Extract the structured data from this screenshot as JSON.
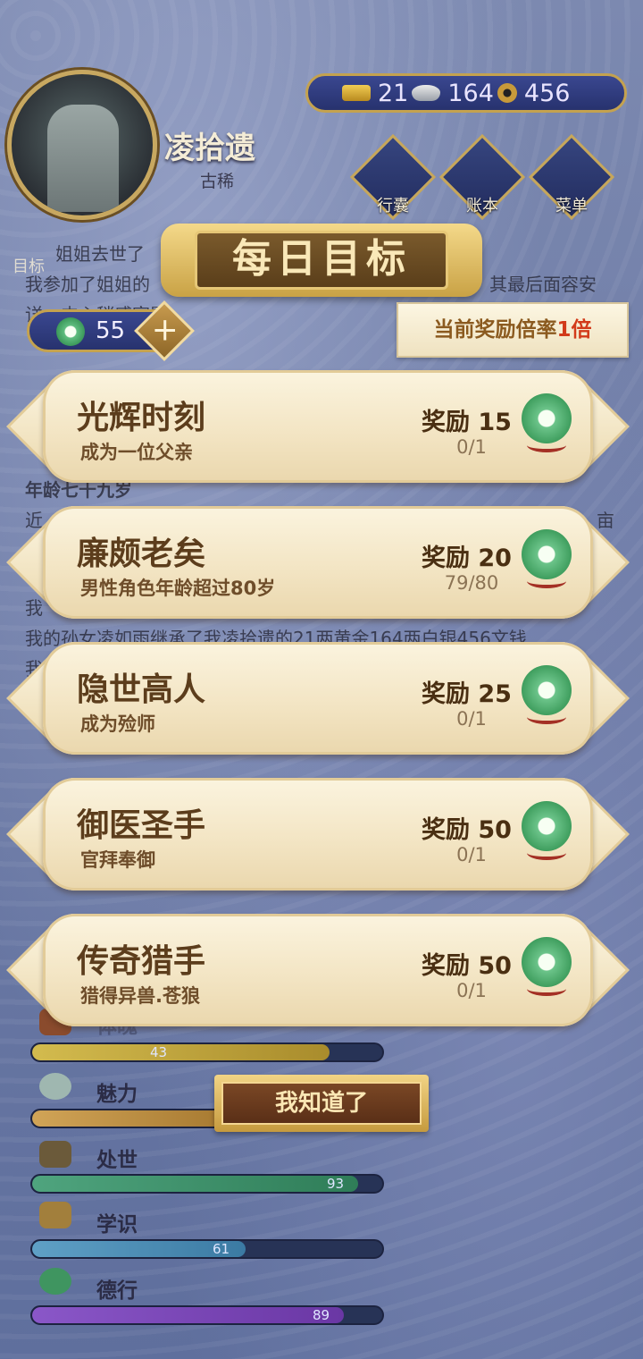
{
  "header": {
    "character_name": "凌拾遗",
    "character_age_label": "古稀",
    "currency": {
      "gold": "21",
      "silver": "164",
      "coins": "456"
    },
    "menu": [
      {
        "label": "行囊",
        "icon": "bag-icon"
      },
      {
        "label": "账本",
        "icon": "ledger-icon"
      },
      {
        "label": "菜单",
        "icon": "more-icon"
      }
    ],
    "goal_label": "目标"
  },
  "background_text": {
    "line1": "姐姐去世了",
    "line2": "我参加了姐姐的",
    "line2b": "其最后面容安",
    "line3": "详，内心稍感宽慰",
    "age_line": "年龄七十九岁",
    "line4": "近",
    "line4b": "亩",
    "line5": "我",
    "line6": "我的孙女凌如雨继承了我凌拾遗的21两黄金164两白银456文钱",
    "line7": "我"
  },
  "jade_balance": "55",
  "dialog": {
    "title": "每日目标",
    "multiplier_prefix": "当前奖励倍率",
    "multiplier_value": "1倍",
    "goals": [
      {
        "title": "光辉时刻",
        "desc": "成为一位父亲",
        "reward_label": "奖励 15",
        "progress": "0/1"
      },
      {
        "title": "廉颇老矣",
        "desc": "男性角色年龄超过80岁",
        "reward_label": "奖励 20",
        "progress": "79/80"
      },
      {
        "title": "隐世高人",
        "desc": "成为殓师",
        "reward_label": "奖励 25",
        "progress": "0/1"
      },
      {
        "title": "御医圣手",
        "desc": "官拜奉御",
        "reward_label": "奖励 50",
        "progress": "0/1"
      },
      {
        "title": "传奇猎手",
        "desc": "猎得异兽.苍狼",
        "reward_label": "奖励 50",
        "progress": "0/1"
      }
    ],
    "confirm_label": "我知道了"
  },
  "stats": [
    {
      "label": "体魄",
      "value": "43",
      "fraction": 0.43,
      "color": "#c9b04a"
    },
    {
      "label": "魅力",
      "value": "",
      "fraction": 0.55,
      "color": "#c89a4c"
    },
    {
      "label": "处世",
      "value": "93",
      "fraction": 0.93,
      "color": "#4aa178"
    },
    {
      "label": "学识",
      "value": "61",
      "fraction": 0.61,
      "color": "#5a9ac0"
    },
    {
      "label": "德行",
      "value": "89",
      "fraction": 0.89,
      "color": "#7f4cc0"
    }
  ]
}
